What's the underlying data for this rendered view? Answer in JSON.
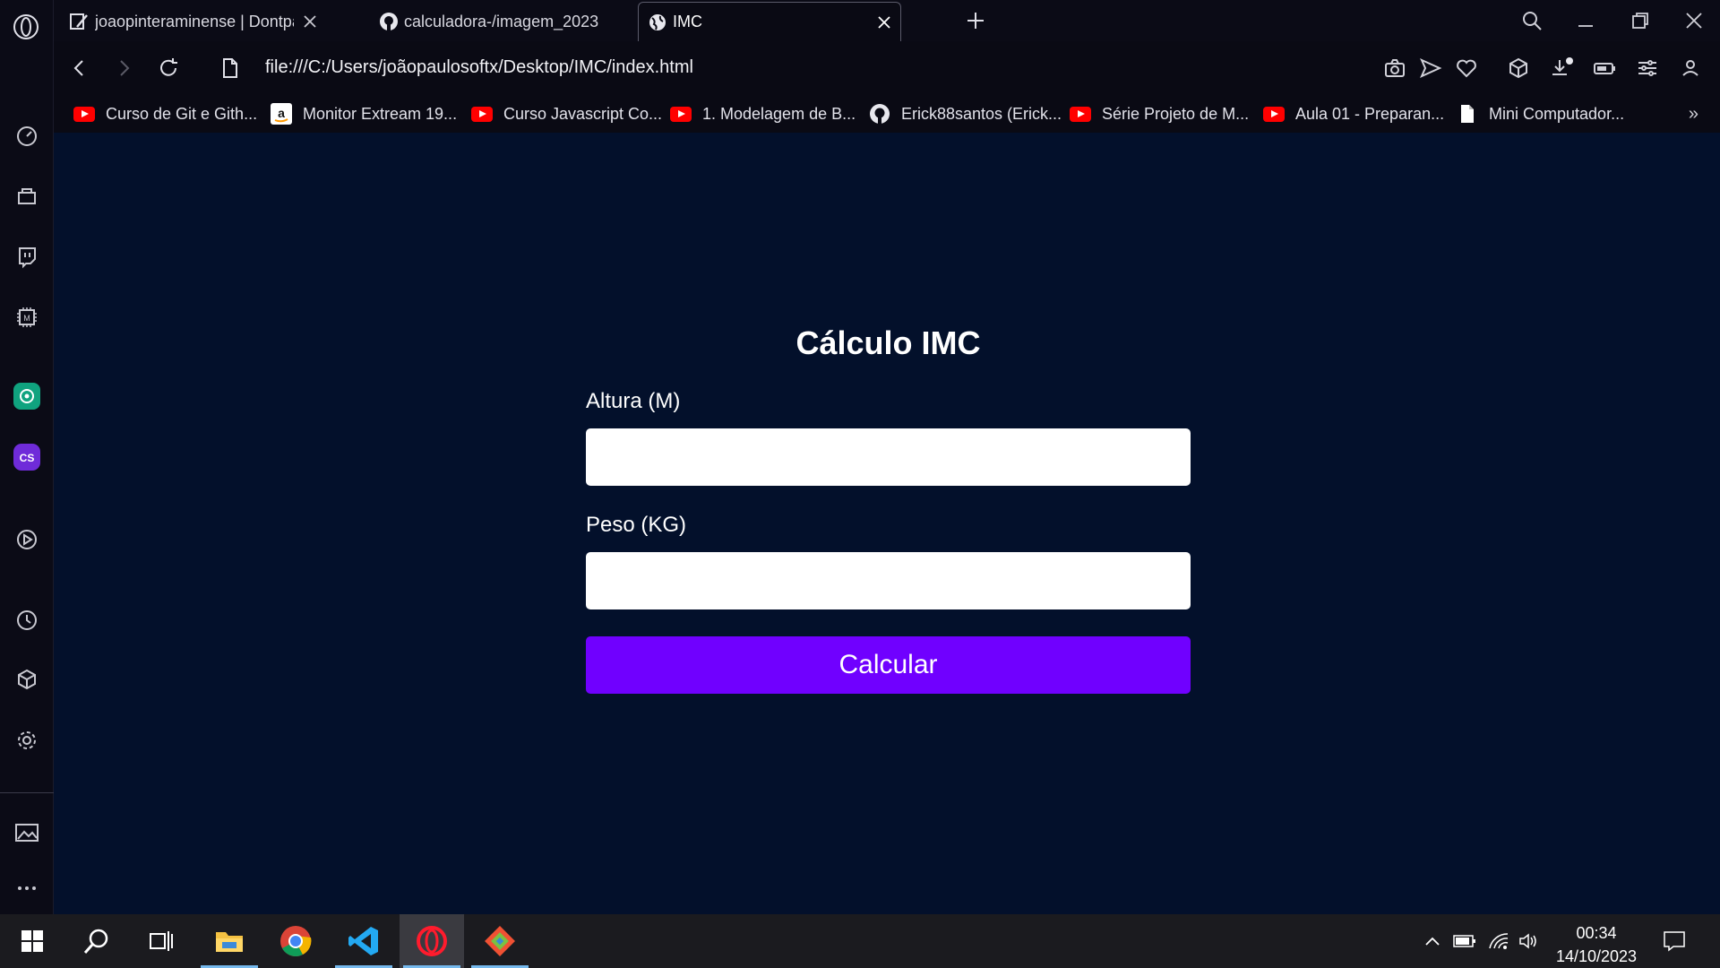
{
  "browser": {
    "tabs": [
      {
        "title": "joaopinteraminense | Dontpad",
        "icon": "dontpad-icon",
        "active": false
      },
      {
        "title": "calculadora-/imagem_2023",
        "icon": "github-icon",
        "active": false
      },
      {
        "title": "IMC",
        "icon": "globe-icon",
        "active": true
      }
    ],
    "address": "file:///C:/Users/joãopaulosoftx/Desktop/IMC/index.html",
    "bookmarks": [
      {
        "label": "Curso de Git e Gith...",
        "icon": "youtube-icon"
      },
      {
        "label": "Monitor Extream 19...",
        "icon": "amazon-icon"
      },
      {
        "label": "Curso Javascript Co...",
        "icon": "youtube-icon"
      },
      {
        "label": "1. Modelagem de B...",
        "icon": "youtube-icon"
      },
      {
        "label": "Erick88santos (Erick...",
        "icon": "github-icon"
      },
      {
        "label": "Série Projeto de M...",
        "icon": "youtube-icon"
      },
      {
        "label": "Aula 01 - Preparan...",
        "icon": "youtube-icon"
      },
      {
        "label": "Mini Computador...",
        "icon": "file-icon"
      }
    ],
    "more_bookmarks": "»"
  },
  "page": {
    "title": "Cálculo IMC",
    "height_label": "Altura (M)",
    "height_value": "",
    "weight_label": "Peso (KG)",
    "weight_value": "",
    "button_label": "Calcular"
  },
  "colors": {
    "page_bg": "#03102b",
    "button_bg": "#7000ff"
  },
  "taskbar": {
    "time": "00:34",
    "date": "14/10/2023"
  }
}
